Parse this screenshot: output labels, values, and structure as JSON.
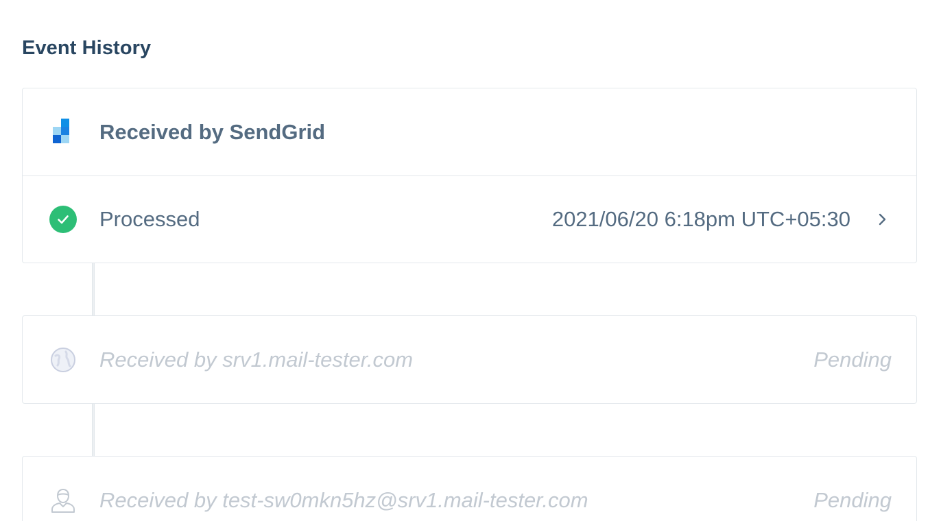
{
  "section": {
    "title": "Event History"
  },
  "sendgrid": {
    "label": "Received by SendGrid",
    "icon": "sendgrid-logo-icon",
    "colors": {
      "light": "#9dd6f4",
      "mid": "#1a82e2",
      "dark": "#0f64d2"
    }
  },
  "processed": {
    "label": "Processed",
    "timestamp": "2021/06/20 6:18pm UTC+05:30",
    "icon": "check-circle-icon",
    "status_color": "#2dbe76"
  },
  "server": {
    "label": "Received by srv1.mail-tester.com",
    "status": "Pending",
    "icon": "globe-icon"
  },
  "recipient": {
    "label": "Received by test-sw0mkn5hz@srv1.mail-tester.com",
    "status": "Pending",
    "icon": "user-icon"
  }
}
